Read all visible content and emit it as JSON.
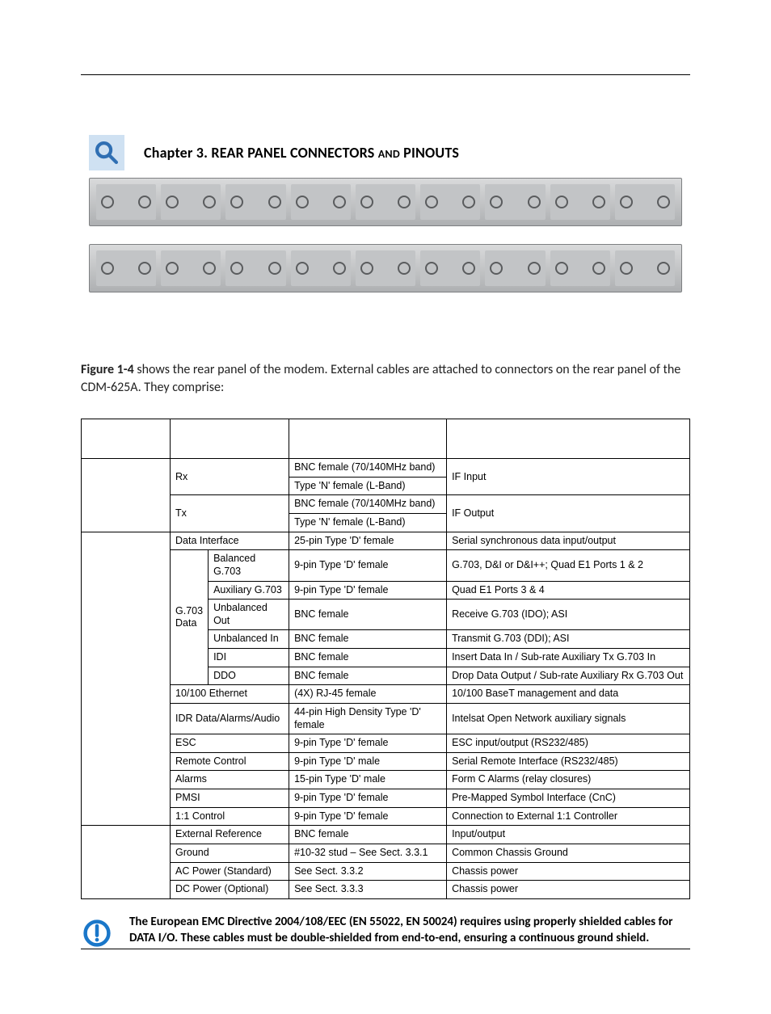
{
  "chapter": {
    "title_pre": "Chapter 3. REAR PANEL CONNECTORS ",
    "title_and": "AND",
    "title_post": " PINOUTS"
  },
  "intro": {
    "bold": "Figure 1-4",
    "rest": " shows the rear panel of the modem. External cables are attached to connectors on the rear panel of the CDM-625A. They comprise:"
  },
  "table": {
    "col0_top": "",
    "rx": "Rx",
    "tx": "Tx",
    "rx_bnc": "BNC female (70/140MHz band)",
    "rx_n": "Type 'N' female (L-Band)",
    "tx_bnc": "BNC female (70/140MHz band)",
    "tx_n": "Type 'N' female (L-Band)",
    "if_input": "IF Input",
    "if_output": "IF Output",
    "data_interface": "Data Interface",
    "data_interface_type": "25-pin Type 'D' female",
    "data_interface_desc": "Serial synchronous data input/output",
    "g703": "G.703 Data",
    "bal_g703": "Balanced G.703",
    "bal_g703_type": "9-pin Type 'D' female",
    "bal_g703_desc": "G.703, D&I or D&I++; Quad E1 Ports 1 & 2",
    "aux_g703": "Auxiliary G.703",
    "aux_g703_type": "9-pin Type 'D' female",
    "aux_g703_desc": "Quad E1 Ports 3 & 4",
    "unbal_out": "Unbalanced Out",
    "unbal_out_type": "BNC female",
    "unbal_out_desc": "Receive G.703 (IDO); ASI",
    "unbal_in": "Unbalanced In",
    "unbal_in_type": "BNC female",
    "unbal_in_desc": "Transmit G.703 (DDI); ASI",
    "idi": "IDI",
    "idi_type": "BNC female",
    "idi_desc": "Insert Data In / Sub-rate Auxiliary Tx G.703 In",
    "ddo": "DDO",
    "ddo_type": "BNC female",
    "ddo_desc": "Drop Data Output / Sub-rate Auxiliary Rx G.703 Out",
    "eth": "10/100 Ethernet",
    "eth_type": "(4X) RJ-45 female",
    "eth_desc": "10/100 BaseT management and data",
    "idr": "IDR Data/Alarms/Audio",
    "idr_type": "44-pin High Density Type 'D' female",
    "idr_desc": "Intelsat Open Network auxiliary signals",
    "esc": "ESC",
    "esc_type": "9-pin Type 'D' female",
    "esc_desc": "ESC input/output (RS232/485)",
    "remote": "Remote Control",
    "remote_type": "9-pin Type 'D' male",
    "remote_desc": "Serial Remote Interface (RS232/485)",
    "alarms": "Alarms",
    "alarms_type": "15-pin Type 'D' male",
    "alarms_desc": "Form C Alarms (relay closures)",
    "pmsi": "PMSI",
    "pmsi_type": "9-pin Type 'D' female",
    "pmsi_desc": "Pre-Mapped Symbol Interface (CnC)",
    "ctl": "1:1 Control",
    "ctl_type": "9-pin Type 'D' female",
    "ctl_desc": "Connection to External 1:1 Controller",
    "extref": "External Reference",
    "extref_type": "BNC female",
    "extref_desc": "Input/output",
    "ground": "Ground",
    "ground_type": "#10-32 stud – See Sect. 3.3.1",
    "ground_desc": "Common Chassis Ground",
    "ac": "AC Power (Standard)",
    "ac_type": "See Sect. 3.3.2",
    "ac_desc": "Chassis power",
    "dc": "DC Power (Optional)",
    "dc_type": "See Sect. 3.3.3",
    "dc_desc": "Chassis power"
  },
  "note": "The European EMC Directive 2004/108/EEC  (EN 55022, EN 50024) requires using properly shielded cables for DATA I/O. These cables must be double-shielded from end-to-end, ensuring a continuous ground shield."
}
